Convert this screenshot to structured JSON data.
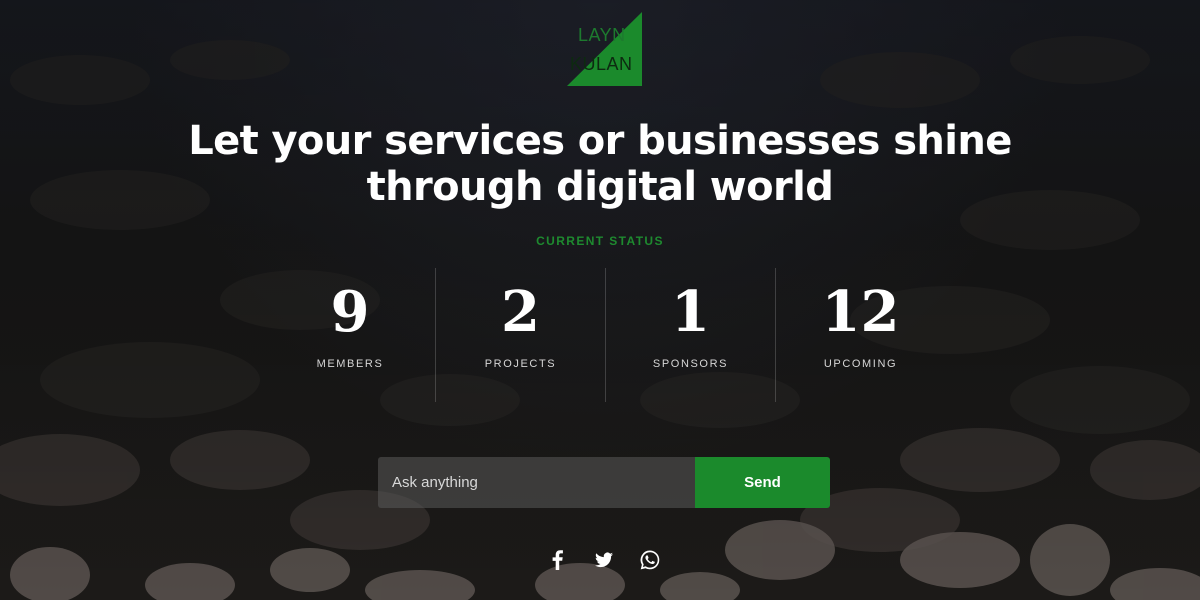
{
  "logo": {
    "line1": "LAYN",
    "line2": "KULAN",
    "color": "#1b8a2c"
  },
  "headline": {
    "line1": "Let your services or businesses shine",
    "line2": "through digital world"
  },
  "status": {
    "label": "CURRENT STATUS",
    "color": "#1e8a2f",
    "items": [
      {
        "value": "9",
        "label": "MEMBERS"
      },
      {
        "value": "2",
        "label": "PROJECTS"
      },
      {
        "value": "1",
        "label": "SPONSORS"
      },
      {
        "value": "12",
        "label": "UPCOMING"
      }
    ]
  },
  "ask": {
    "placeholder": "Ask anything",
    "button_label": "Send"
  },
  "social": [
    {
      "icon": "facebook-icon"
    },
    {
      "icon": "twitter-icon"
    },
    {
      "icon": "whatsapp-icon"
    }
  ]
}
